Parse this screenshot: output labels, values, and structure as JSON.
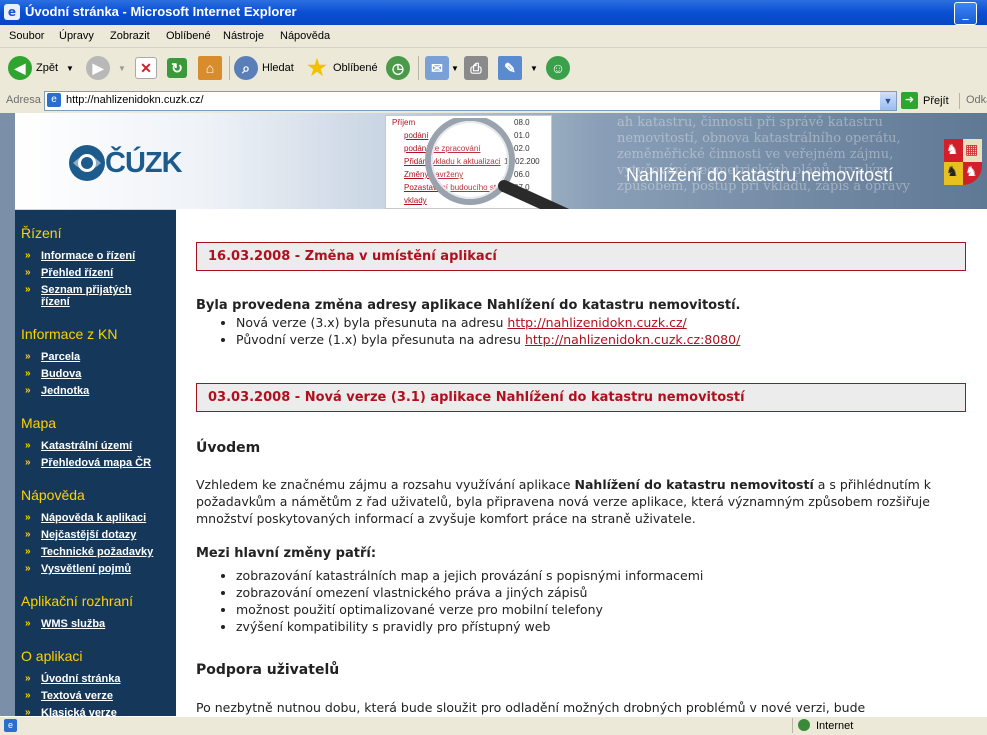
{
  "window": {
    "title": "Úvodní stránka - Microsoft Internet Explorer"
  },
  "menu": [
    "Soubor",
    "Úpravy",
    "Zobrazit",
    "Oblíbené",
    "Nástroje",
    "Nápověda"
  ],
  "toolbar": {
    "back": "Zpět",
    "search": "Hledat",
    "favorites": "Oblíbené"
  },
  "address": {
    "label": "Adresa",
    "url": "http://nahlizenidokn.cuzk.cz/",
    "go": "Přejít",
    "links": "Odka"
  },
  "banner": {
    "logo": "ČÚZK",
    "title": "Nahlížení do katastru nemovitostí",
    "paper_rows": [
      "Příjem",
      "podání",
      "podání ke zpracování",
      "Přidání vkladu k aktualizaci",
      "Změny navrženy",
      "Pozastavení budoucího stavu",
      "vklady"
    ],
    "paper_dates": [
      "08.0",
      "01.0",
      "02.0",
      "13.02.200",
      "06.0",
      "07.0"
    ],
    "bg_text": "ah katastru, činnosti při správě katastru nemovitostí, obnova katastrálního operátu, zeměměřické činnosti ve veřejném zájmu, vytyčování geometrických plánů, trvalým způsobem, postup při vkladu, zápis a opravy"
  },
  "sidebar": {
    "sections": [
      {
        "heading": "Řízení",
        "items": [
          "Informace o řízení",
          "Přehled řízení",
          "Seznam přijatých řízení"
        ]
      },
      {
        "heading": "Informace z KN",
        "items": [
          "Parcela",
          "Budova",
          "Jednotka"
        ]
      },
      {
        "heading": "Mapa",
        "items": [
          "Katastrální území",
          "Přehledová mapa ČR"
        ]
      },
      {
        "heading": "Nápověda",
        "items": [
          "Nápověda k aplikaci",
          "Nejčastější dotazy",
          "Technické požadavky",
          "Vysvětlení pojmů"
        ]
      },
      {
        "heading": "Aplikační rozhraní",
        "items": [
          "WMS služba"
        ]
      },
      {
        "heading": "O aplikaci",
        "items": [
          "Úvodní stránka",
          "Textová verze",
          "Klasická verze"
        ]
      }
    ]
  },
  "content": {
    "news1": {
      "heading": "16.03.2008 - Změna v umístění aplikací",
      "intro": "Byla provedena změna adresy aplikace Nahlížení do katastru nemovitostí.",
      "item1_text": "Nová verze (3.x) byla přesunuta na adresu ",
      "item1_link": "http://nahlizenidokn.cuzk.cz/",
      "item2_text": "Původní verze (1.x) byla přesunuta na adresu ",
      "item2_link": "http://nahlizenidokn.cuzk.cz:8080/"
    },
    "news2": {
      "heading": "03.03.2008 - Nová verze (3.1) aplikace Nahlížení do katastru nemovitostí",
      "subheading": "Úvodem",
      "para_pre": "Vzhledem ke značnému zájmu a rozsahu využívání aplikace ",
      "para_bold": "Nahlížení do katastru nemovitostí",
      "para_post": " a s přihlédnutím k požadavkům a námětům z řad uživatelů, byla připravena nová verze aplikace, která významným způsobem rozšiřuje množství poskytovaných informací a zvyšuje komfort práce na straně uživatele.",
      "changes_heading": "Mezi hlavní změny patří:",
      "changes": [
        "zobrazování katastrálních map a jejich provázání s popisnými informacemi",
        "zobrazování omezení vlastnického práva a jiných zápisů",
        "možnost použití optimalizované verze pro mobilní telefony",
        "zvýšení kompatibility s pravidly pro přístupný web"
      ],
      "support_heading": "Podpora uživatelů",
      "support_para": "Po nezbytně nutnou dobu, která bude sloužit pro odladění možných drobných problémů v nové verzi, bude"
    }
  },
  "status": {
    "zone": "Internet"
  }
}
